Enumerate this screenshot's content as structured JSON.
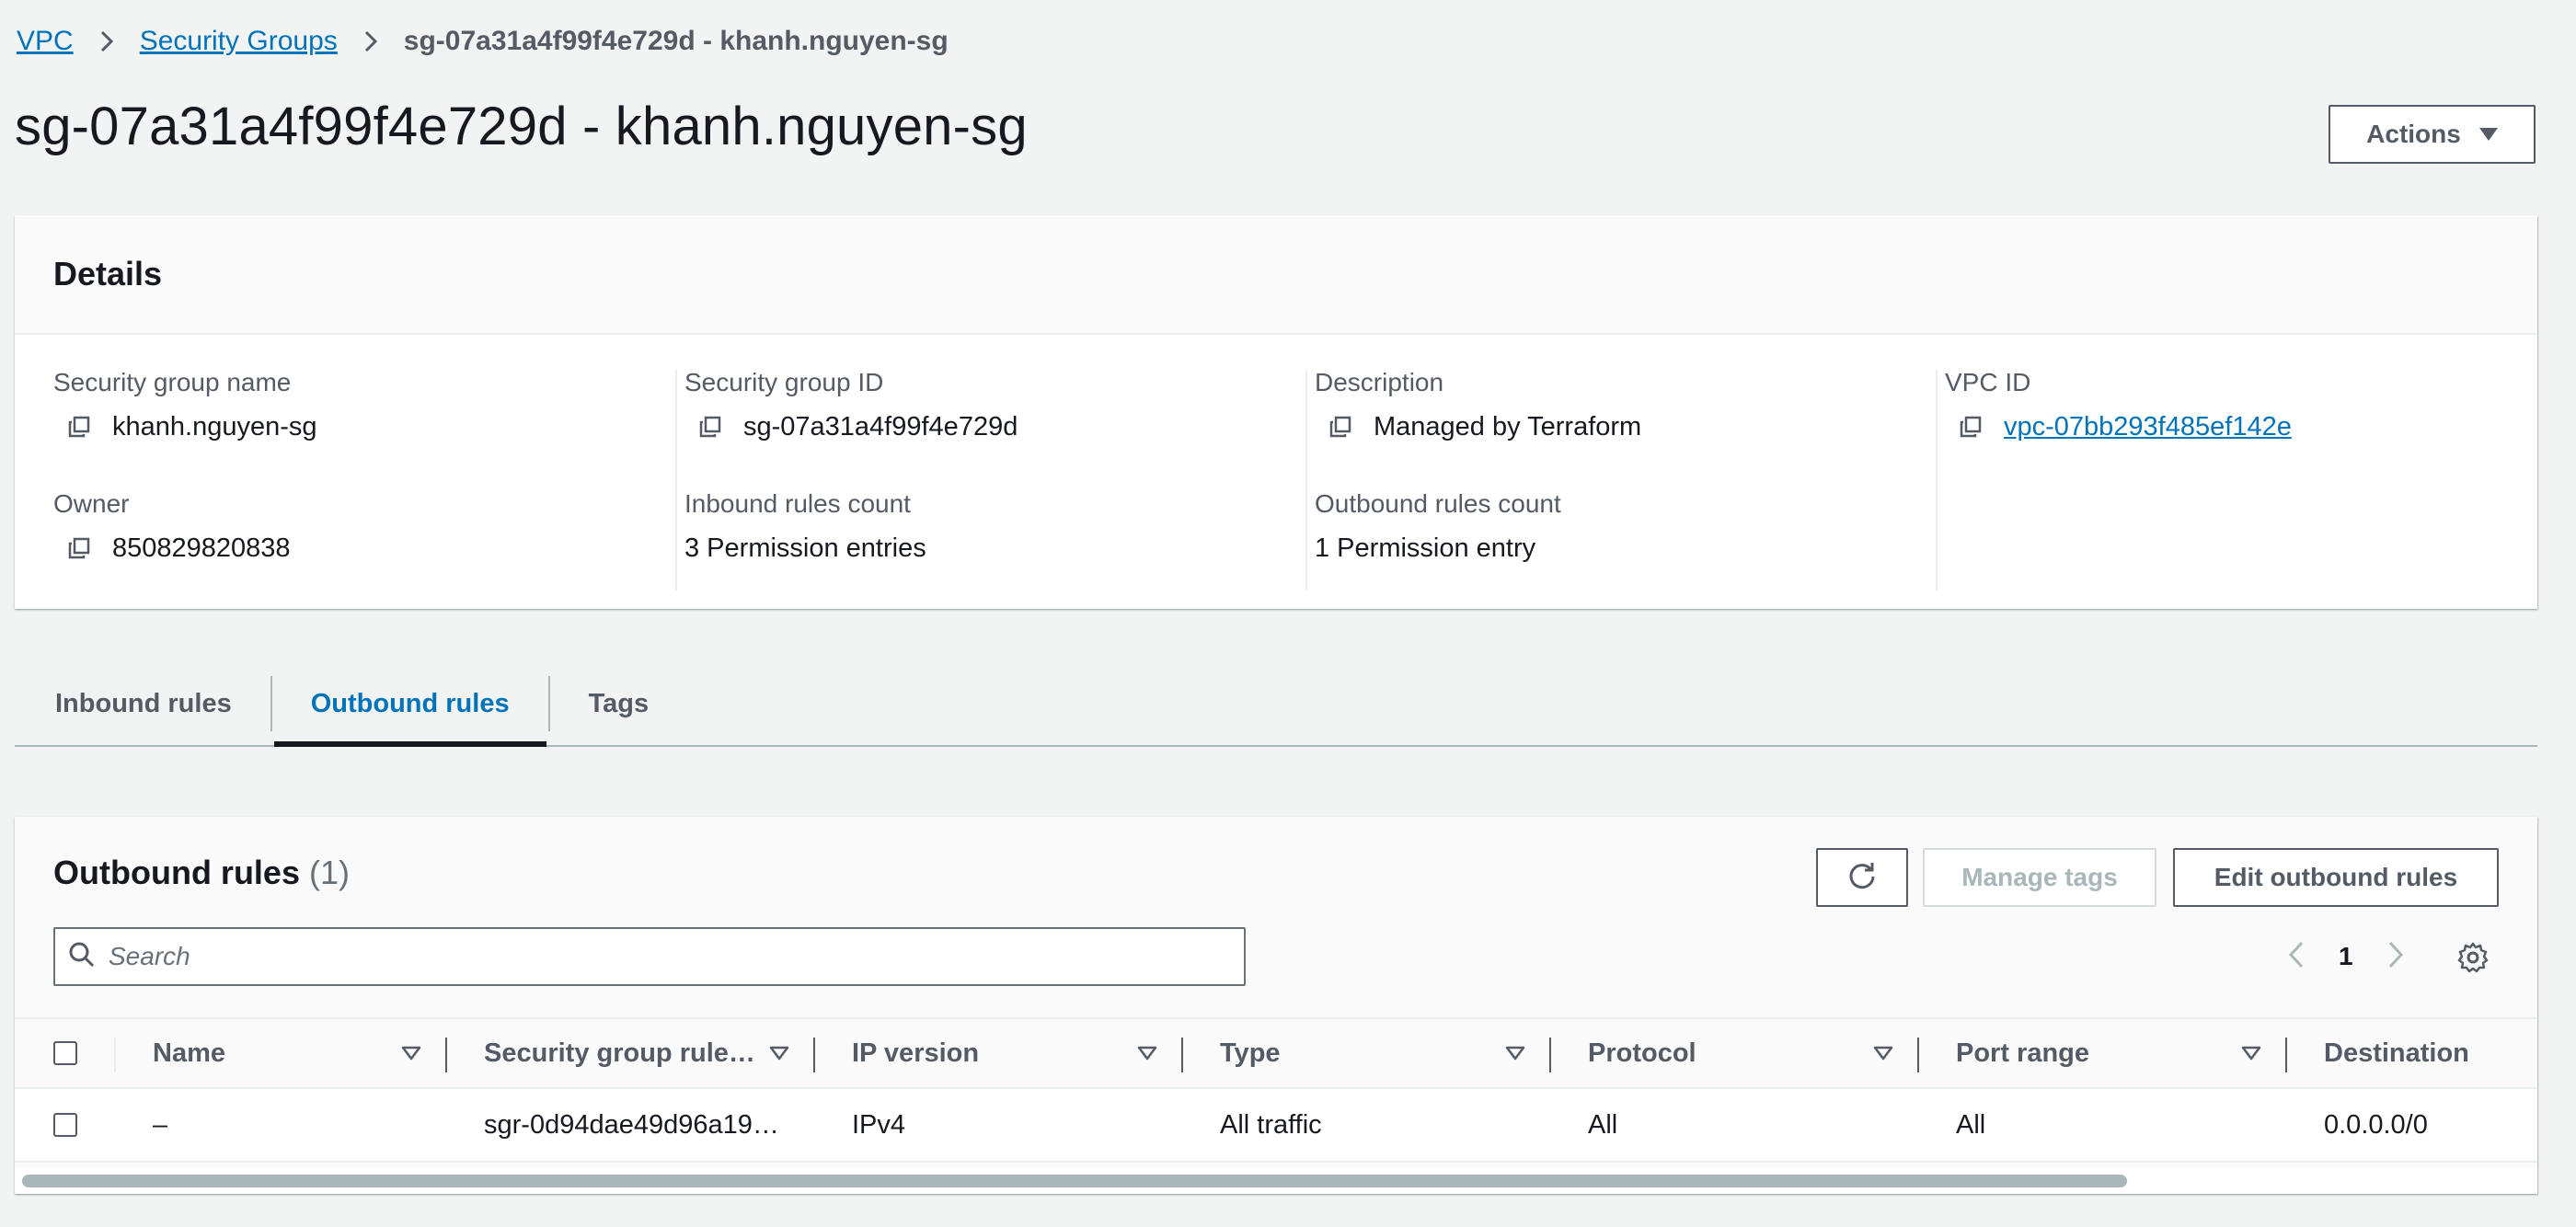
{
  "breadcrumb": {
    "items": [
      {
        "label": "VPC"
      },
      {
        "label": "Security Groups"
      }
    ],
    "current": "sg-07a31a4f99f4e729d - khanh.nguyen-sg"
  },
  "page": {
    "title": "sg-07a31a4f99f4e729d - khanh.nguyen-sg",
    "actions_label": "Actions"
  },
  "details": {
    "heading": "Details",
    "fields": {
      "sg_name": {
        "label": "Security group name",
        "value": "khanh.nguyen-sg"
      },
      "sg_id": {
        "label": "Security group ID",
        "value": "sg-07a31a4f99f4e729d"
      },
      "description": {
        "label": "Description",
        "value": "Managed by Terraform"
      },
      "vpc_id": {
        "label": "VPC ID",
        "value": "vpc-07bb293f485ef142e"
      },
      "owner": {
        "label": "Owner",
        "value": "850829820838"
      },
      "inbound_count": {
        "label": "Inbound rules count",
        "value": "3 Permission entries"
      },
      "outbound_count": {
        "label": "Outbound rules count",
        "value": "1 Permission entry"
      }
    }
  },
  "tabs": [
    {
      "label": "Inbound rules",
      "active": false
    },
    {
      "label": "Outbound rules",
      "active": true
    },
    {
      "label": "Tags",
      "active": false
    }
  ],
  "outbound": {
    "title": "Outbound rules",
    "count": "(1)",
    "manage_tags_label": "Manage tags",
    "edit_label": "Edit outbound rules",
    "search_placeholder": "Search",
    "page": "1",
    "columns": [
      "Name",
      "Security group rule…",
      "IP version",
      "Type",
      "Protocol",
      "Port range",
      "Destination"
    ],
    "rows": [
      {
        "name": "–",
        "rule_id": "sgr-0d94dae49d96a19…",
        "ip_version": "IPv4",
        "type": "All traffic",
        "protocol": "All",
        "port_range": "All",
        "destination": "0.0.0.0/0"
      }
    ]
  },
  "colors": {
    "link": "#0073bb",
    "text": "#16191f",
    "muted": "#545b64",
    "background": "#f2f3f3"
  },
  "icons": [
    "chevron-right-icon",
    "caret-down-icon",
    "copy-icon",
    "refresh-icon",
    "search-icon",
    "chevron-left-icon",
    "gear-icon",
    "sort-icon"
  ]
}
